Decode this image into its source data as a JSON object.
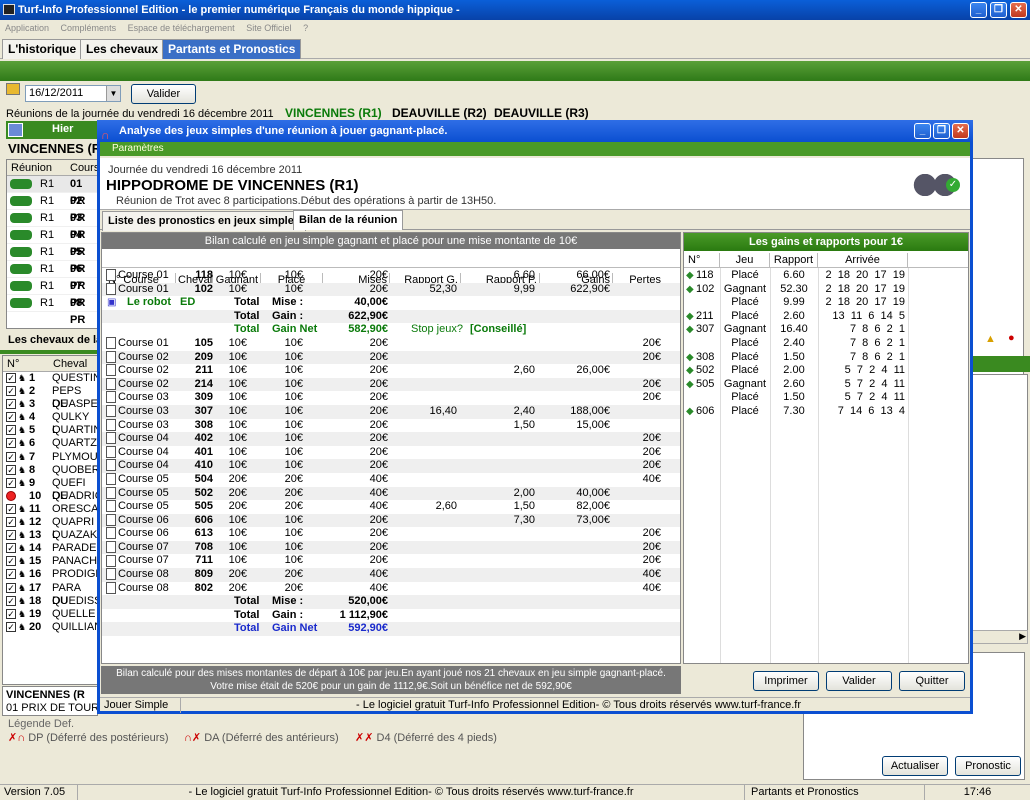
{
  "window": {
    "title": "Turf-Info Professionnel Edition - le premier numérique Français du monde hippique -"
  },
  "menu": [
    "Application",
    "Compléments",
    "Espace de téléchargement",
    "Site Officiel",
    "?"
  ],
  "tabs": [
    "L'historique",
    "Les chevaux",
    "Partants et Pronostics"
  ],
  "date": {
    "value": "16/12/2011",
    "valider": "Valider"
  },
  "reunions": {
    "text": "Réunions de la journée du vendredi 16 décembre 2011",
    "r1": "VINCENNES (R1)",
    "r2": "DEAUVILLE (R2)",
    "r3": "DEAUVILLE (R3)"
  },
  "left": {
    "hier": "Hier",
    "vincennes": "VINCENNES (R",
    "col_reunion": "Réunion",
    "col_course": "Cours",
    "courses": [
      {
        "r": "R1",
        "c": "01 PR"
      },
      {
        "r": "R1",
        "c": "02 PR"
      },
      {
        "r": "R1",
        "c": "03 PR"
      },
      {
        "r": "R1",
        "c": "04 PR"
      },
      {
        "r": "R1",
        "c": "05 PR"
      },
      {
        "r": "R1",
        "c": "06 PR"
      },
      {
        "r": "R1",
        "c": "07 PR"
      },
      {
        "r": "R1",
        "c": "08 PR"
      }
    ],
    "chevaux_label": "Les chevaux de la",
    "col_no": "N°",
    "col_cheval": "Cheval",
    "horses": [
      {
        "n": "1",
        "name": "QUESTIN"
      },
      {
        "n": "2",
        "name": "PEPS DE"
      },
      {
        "n": "3",
        "name": "QUASPE"
      },
      {
        "n": "4",
        "name": "QULKY L"
      },
      {
        "n": "5",
        "name": "QUARTIN"
      },
      {
        "n": "6",
        "name": "QUARTZ"
      },
      {
        "n": "7",
        "name": "PLYMOU"
      },
      {
        "n": "8",
        "name": "QUOBER"
      },
      {
        "n": "9",
        "name": "QUEFI DE"
      },
      {
        "n": "10",
        "name": "QUADRIG"
      },
      {
        "n": "11",
        "name": "ORESCA"
      },
      {
        "n": "12",
        "name": "QUAPRI L"
      },
      {
        "n": "13",
        "name": "QUAZAKO"
      },
      {
        "n": "14",
        "name": "PARADE"
      },
      {
        "n": "15",
        "name": "PANACHE"
      },
      {
        "n": "16",
        "name": "PRODIGE"
      },
      {
        "n": "17",
        "name": "PARA DU"
      },
      {
        "n": "18",
        "name": "QUEDISS"
      },
      {
        "n": "19",
        "name": "QUELLE"
      },
      {
        "n": "20",
        "name": "QUILLIAN"
      }
    ],
    "bottom_vincennes": "VINCENNES (R",
    "bottom_prix": "01 PRIX DE TOURC"
  },
  "legende": {
    "title": "Légende Def.",
    "dp": "DP (Déferré des postérieurs)",
    "da": "DA (Déferré des antérieurs)",
    "d4": "D4 (Déferré des 4 pieds)"
  },
  "right_buttons": {
    "actualiser": "Actualiser",
    "pronostic": "Pronostic"
  },
  "dialog": {
    "title": "Analyse des jeux simples d'une réunion à jouer gagnant-placé.",
    "parametres": "Paramètres",
    "journee": "Journée du vendredi 16 décembre 2011",
    "hippodrome": "HIPPODROME DE  VINCENNES (R1)",
    "info": "Réunion de Trot avec 8 participations.Début des opérations à partir de 13H50.",
    "tab1": "Liste des pronostics en jeux simples",
    "tab2": "Bilan de la réunion",
    "bilan_head": "Bilan calculé en jeu simple gagnant et placé pour une mise montante de 10€",
    "cols": [
      "N° Course",
      "Cheval",
      "Gagnant",
      "Placé",
      "Mises",
      "Rapport G.",
      "Rapport P.",
      "Gains",
      "Pertes"
    ],
    "block1": [
      {
        "course": "Course 01",
        "cheval": "118",
        "g": "10€",
        "p": "10€",
        "mises": "20€",
        "rg": "",
        "rp": "6,60",
        "gains": "66,00€",
        "pertes": ""
      },
      {
        "course": "Course 01",
        "cheval": "102",
        "g": "10€",
        "p": "10€",
        "mises": "20€",
        "rg": "52,30",
        "rp": "9,99",
        "gains": "622,90€",
        "pertes": ""
      }
    ],
    "robot": "Le robot",
    "robot_ed": "ED",
    "tot1": {
      "total": "Total",
      "mise_l": "Mise :",
      "mise": "40,00€",
      "gain_l": "Gain :",
      "gain": "622,90€",
      "net_l": "Gain Net",
      "net": "582,90€",
      "stop": "Stop jeux?",
      "conseil": "[Conseillé]"
    },
    "block2": [
      {
        "course": "Course 01",
        "cheval": "105",
        "g": "10€",
        "p": "10€",
        "mises": "20€",
        "rg": "",
        "rp": "",
        "gains": "",
        "pertes": "20€"
      },
      {
        "course": "Course 02",
        "cheval": "209",
        "g": "10€",
        "p": "10€",
        "mises": "20€",
        "rg": "",
        "rp": "",
        "gains": "",
        "pertes": "20€"
      },
      {
        "course": "Course 02",
        "cheval": "211",
        "g": "10€",
        "p": "10€",
        "mises": "20€",
        "rg": "",
        "rp": "2,60",
        "gains": "26,00€",
        "pertes": ""
      },
      {
        "course": "Course 02",
        "cheval": "214",
        "g": "10€",
        "p": "10€",
        "mises": "20€",
        "rg": "",
        "rp": "",
        "gains": "",
        "pertes": "20€"
      },
      {
        "course": "Course 03",
        "cheval": "309",
        "g": "10€",
        "p": "10€",
        "mises": "20€",
        "rg": "",
        "rp": "",
        "gains": "",
        "pertes": "20€"
      },
      {
        "course": "Course 03",
        "cheval": "307",
        "g": "10€",
        "p": "10€",
        "mises": "20€",
        "rg": "16,40",
        "rp": "2,40",
        "gains": "188,00€",
        "pertes": ""
      },
      {
        "course": "Course 03",
        "cheval": "308",
        "g": "10€",
        "p": "10€",
        "mises": "20€",
        "rg": "",
        "rp": "1,50",
        "gains": "15,00€",
        "pertes": ""
      },
      {
        "course": "Course 04",
        "cheval": "402",
        "g": "10€",
        "p": "10€",
        "mises": "20€",
        "rg": "",
        "rp": "",
        "gains": "",
        "pertes": "20€"
      },
      {
        "course": "Course 04",
        "cheval": "401",
        "g": "10€",
        "p": "10€",
        "mises": "20€",
        "rg": "",
        "rp": "",
        "gains": "",
        "pertes": "20€"
      },
      {
        "course": "Course 04",
        "cheval": "410",
        "g": "10€",
        "p": "10€",
        "mises": "20€",
        "rg": "",
        "rp": "",
        "gains": "",
        "pertes": "20€"
      },
      {
        "course": "Course 05",
        "cheval": "504",
        "g": "20€",
        "p": "20€",
        "mises": "40€",
        "rg": "",
        "rp": "",
        "gains": "",
        "pertes": "40€"
      },
      {
        "course": "Course 05",
        "cheval": "502",
        "g": "20€",
        "p": "20€",
        "mises": "40€",
        "rg": "",
        "rp": "2,00",
        "gains": "40,00€",
        "pertes": ""
      },
      {
        "course": "Course 05",
        "cheval": "505",
        "g": "20€",
        "p": "20€",
        "mises": "40€",
        "rg": "2,60",
        "rp": "1,50",
        "gains": "82,00€",
        "pertes": ""
      },
      {
        "course": "Course 06",
        "cheval": "606",
        "g": "10€",
        "p": "10€",
        "mises": "20€",
        "rg": "",
        "rp": "7,30",
        "gains": "73,00€",
        "pertes": ""
      },
      {
        "course": "Course 06",
        "cheval": "613",
        "g": "10€",
        "p": "10€",
        "mises": "20€",
        "rg": "",
        "rp": "",
        "gains": "",
        "pertes": "20€"
      },
      {
        "course": "Course 07",
        "cheval": "708",
        "g": "10€",
        "p": "10€",
        "mises": "20€",
        "rg": "",
        "rp": "",
        "gains": "",
        "pertes": "20€"
      },
      {
        "course": "Course 07",
        "cheval": "711",
        "g": "10€",
        "p": "10€",
        "mises": "20€",
        "rg": "",
        "rp": "",
        "gains": "",
        "pertes": "20€"
      },
      {
        "course": "Course 08",
        "cheval": "809",
        "g": "20€",
        "p": "20€",
        "mises": "40€",
        "rg": "",
        "rp": "",
        "gains": "",
        "pertes": "40€"
      },
      {
        "course": "Course 08",
        "cheval": "802",
        "g": "20€",
        "p": "20€",
        "mises": "40€",
        "rg": "",
        "rp": "",
        "gains": "",
        "pertes": "40€"
      }
    ],
    "tot2": {
      "total": "Total",
      "mise_l": "Mise :",
      "mise": "520,00€",
      "gain_l": "Gain :",
      "gain": "1 112,90€",
      "net_l": "Gain Net",
      "net": "592,90€"
    },
    "gains_head": "Les gains et rapports pour 1€",
    "gcols": [
      "N°",
      "Jeu",
      "Rapport",
      "Arrivée"
    ],
    "gains": [
      {
        "n": "118",
        "jeu": "Placé",
        "rap": "6.60",
        "arr": "2  18  20  17  19"
      },
      {
        "n": "102",
        "jeu": "Gagnant",
        "rap": "52.30",
        "arr": "2  18  20  17  19"
      },
      {
        "n": "",
        "jeu": "Placé",
        "rap": "9.99",
        "arr": "2  18  20  17  19"
      },
      {
        "n": "211",
        "jeu": "Placé",
        "rap": "2.60",
        "arr": "13  11  6  14  5"
      },
      {
        "n": "307",
        "jeu": "Gagnant",
        "rap": "16.40",
        "arr": "7  8  6  2  1"
      },
      {
        "n": "",
        "jeu": "Placé",
        "rap": "2.40",
        "arr": "7  8  6  2  1"
      },
      {
        "n": "308",
        "jeu": "Placé",
        "rap": "1.50",
        "arr": "7  8  6  2  1"
      },
      {
        "n": "502",
        "jeu": "Placé",
        "rap": "2.00",
        "arr": "5  7  2  4  11"
      },
      {
        "n": "505",
        "jeu": "Gagnant",
        "rap": "2.60",
        "arr": "5  7  2  4  11"
      },
      {
        "n": "",
        "jeu": "Placé",
        "rap": "1.50",
        "arr": "5  7  2  4  11"
      },
      {
        "n": "606",
        "jeu": "Placé",
        "rap": "7.30",
        "arr": "7  14  6  13  4"
      }
    ],
    "foot1": "Bilan calculé pour des mises montantes de départ à 10€ par jeu.En ayant joué nos 21 chevaux en jeu simple gagnant-placé.",
    "foot2": "Votre mise était de 520€ pour un gain de 1112,9€.Soit un bénéfice net de 592,90€",
    "imprimer": "Imprimer",
    "valider": "Valider",
    "quitter": "Quitter",
    "status_left": "Jouer Simple",
    "status_mid": "- Le logiciel gratuit Turf-Info Professionnel Edition- © Tous droits réservés www.turf-france.fr"
  },
  "statusbar": {
    "version": "Version 7.05",
    "copy": "- Le logiciel gratuit Turf-Info Professionnel Edition- © Tous droits réservés www.turf-france.fr",
    "section": "Partants et Pronostics",
    "time": "17:46"
  }
}
